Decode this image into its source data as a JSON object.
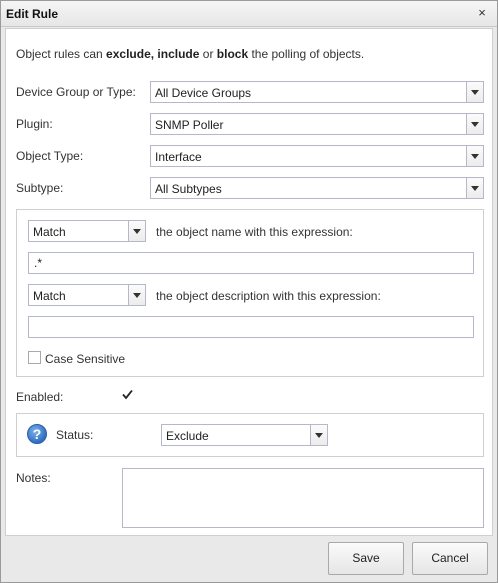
{
  "dialog": {
    "title": "Edit Rule",
    "close_glyph": "×",
    "close_icon": "close-icon"
  },
  "intro": {
    "part1": "Object rules can ",
    "exclude": "exclude,",
    "space1": " ",
    "include": "include",
    "or": " or ",
    "block": "block",
    "part2": " the polling of objects."
  },
  "form": {
    "device_group_label": "Device Group or Type:",
    "device_group_value": "All Device Groups",
    "plugin_label": "Plugin:",
    "plugin_value": "SNMP Poller",
    "object_type_label": "Object Type:",
    "object_type_value": "Interface",
    "subtype_label": "Subtype:",
    "subtype_value": "All Subtypes"
  },
  "expression": {
    "name_match_value": "Match",
    "name_label": "the object name with this expression:",
    "name_expression": ".*",
    "desc_match_value": "Match",
    "desc_label": "the object description with this expression:",
    "desc_expression": "",
    "case_sensitive_label": "Case Sensitive",
    "case_sensitive_checked": false
  },
  "enabled": {
    "label": "Enabled:",
    "checked": true
  },
  "status": {
    "icon": "help-icon",
    "icon_glyph": "?",
    "label": "Status:",
    "value": "Exclude"
  },
  "notes": {
    "label": "Notes:",
    "value": ""
  },
  "buttons": {
    "save": "Save",
    "cancel": "Cancel"
  }
}
